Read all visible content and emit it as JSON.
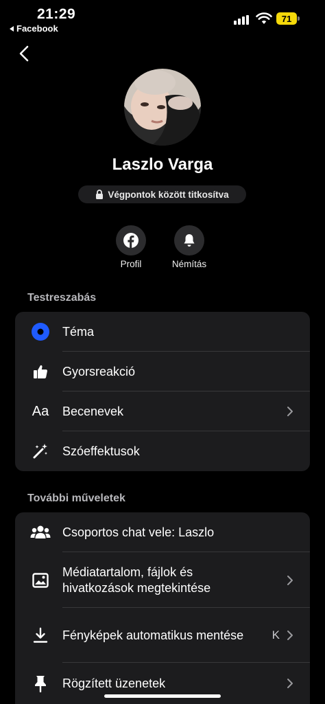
{
  "status_bar": {
    "time": "21:29",
    "back_app": "Facebook",
    "battery": "71"
  },
  "profile": {
    "name": "Laszlo Varga",
    "encryption_label": "Végpontok között titkosítva"
  },
  "actions": [
    {
      "label": "Profil",
      "icon": "facebook-icon"
    },
    {
      "label": "Némítás",
      "icon": "bell-icon"
    }
  ],
  "customize": {
    "title": "Testreszabás",
    "items": [
      {
        "label": "Téma",
        "icon": "theme-dot-icon"
      },
      {
        "label": "Gyorsreakció",
        "icon": "thumbs-up-icon"
      },
      {
        "label": "Becenevek",
        "icon": "text-aa-icon"
      },
      {
        "label": "Szóeffektusok",
        "icon": "magic-wand-icon"
      }
    ]
  },
  "more_actions": {
    "title": "További műveletek",
    "items": [
      {
        "label": "Csoportos chat vele: Laszlo",
        "icon": "group-icon"
      },
      {
        "label_line1": "Médiatartalom, fájlok és",
        "label_line2": "hivatkozások megtekintése",
        "icon": "image-icon"
      },
      {
        "label": "Fényképek automatikus mentése",
        "trailing": "K",
        "icon": "download-icon"
      },
      {
        "label": "Rögzített üzenetek",
        "icon": "pin-icon"
      }
    ]
  },
  "colors": {
    "accent_blue": "#1f5bff",
    "battery_yellow": "#f5d90a",
    "card_bg": "#1c1c1e"
  }
}
